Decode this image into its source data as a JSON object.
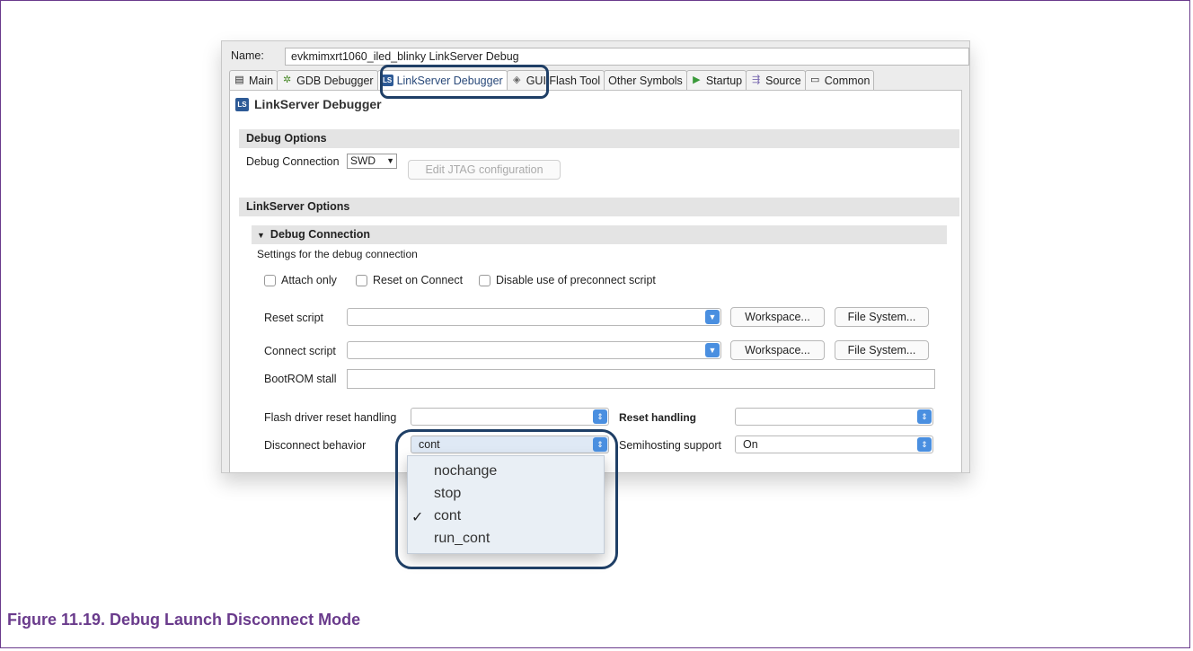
{
  "window": {
    "name_label": "Name:",
    "name_value": "evkmimxrt1060_iled_blinky LinkServer Debug"
  },
  "tabs": [
    {
      "label": "Main",
      "icon": "document-icon"
    },
    {
      "label": "GDB Debugger",
      "icon": "gear-bug-icon"
    },
    {
      "label": "LinkServer Debugger",
      "icon": "ls-icon"
    },
    {
      "label": "GUI Flash Tool",
      "icon": "flash-icon"
    },
    {
      "label": "Other Symbols",
      "icon": "none"
    },
    {
      "label": "Startup",
      "icon": "play-icon"
    },
    {
      "label": "Source",
      "icon": "source-icon"
    },
    {
      "label": "Common",
      "icon": "common-icon"
    }
  ],
  "panel": {
    "title": "LinkServer Debugger",
    "debug_options": {
      "header": "Debug Options",
      "connection_label": "Debug Connection",
      "connection_value": "SWD",
      "edit_jtag_label": "Edit JTAG configuration"
    },
    "linkserver_options": {
      "header": "LinkServer Options",
      "debug_connection_header": "Debug Connection",
      "settings_desc": "Settings for the debug connection",
      "checkboxes": [
        "Attach only",
        "Reset on Connect",
        "Disable use of preconnect script"
      ],
      "reset_script_label": "Reset script",
      "connect_script_label": "Connect script",
      "workspace_label": "Workspace...",
      "filesystem_label": "File System...",
      "bootrom_label": "BootROM stall",
      "flash_driver_label": "Flash driver reset handling",
      "reset_handling_label": "Reset handling",
      "disconnect_label": "Disconnect behavior",
      "disconnect_value": "cont",
      "semihosting_label": "Semihosting support",
      "semihosting_value": "On"
    }
  },
  "dropdown": {
    "options": [
      "nochange",
      "stop",
      "cont",
      "run_cont"
    ],
    "selected": "cont",
    "check_mark": "✓"
  },
  "caption": "Figure 11.19. Debug Launch Disconnect Mode",
  "colors": {
    "caption": "#6a3b8c",
    "highlight_outline": "#1f3f66",
    "combo_arrow": "#4a8fe0"
  }
}
